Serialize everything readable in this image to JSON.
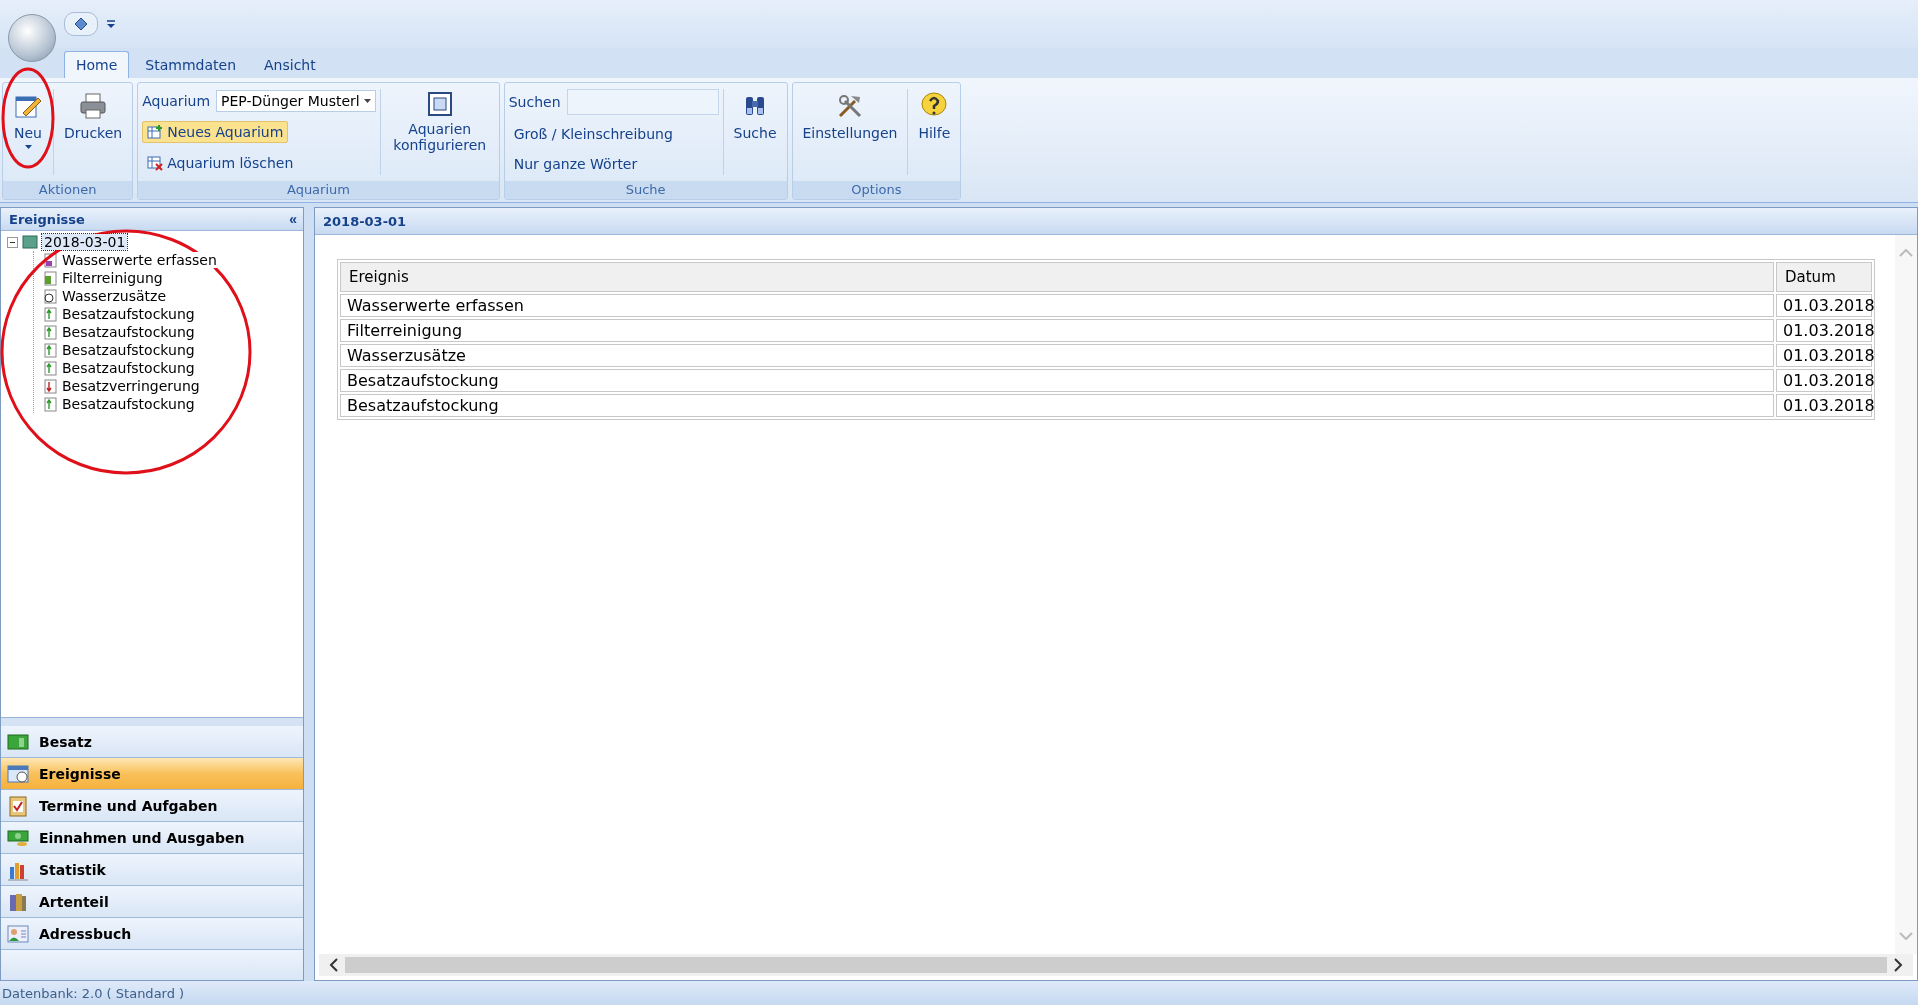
{
  "ribbon_tabs": [
    {
      "label": "Home",
      "selected": true
    },
    {
      "label": "Stammdaten",
      "selected": false
    },
    {
      "label": "Ansicht",
      "selected": false
    }
  ],
  "ribbon_groups": [
    {
      "title": "Aktionen",
      "kind": "actions",
      "buttons": [
        {
          "label": "Neu",
          "dropdown": true
        },
        {
          "label": "Drucken",
          "dropdown": false
        }
      ]
    },
    {
      "title": "Aquarium",
      "kind": "aquarium",
      "field_label": "Aquarium",
      "combo_value": "PEP-Dünger Musterl",
      "new_button": "Neues Aquarium",
      "delete_button": "Aquarium löschen",
      "configure_button": "Aquarien konfigurieren"
    },
    {
      "title": "Suche",
      "kind": "search",
      "field_label": "Suchen",
      "options": [
        "Groß / Kleinschreibung",
        "Nur ganze Wörter"
      ],
      "search_button": "Suche"
    },
    {
      "title": "Options",
      "kind": "actions",
      "buttons": [
        {
          "label": "Einstellungen",
          "dropdown": false
        },
        {
          "label": "Hilfe",
          "dropdown": false
        }
      ]
    }
  ],
  "sidebar": {
    "title": "Ereignisse",
    "collapse": "«",
    "tree": [
      {
        "label": "2018-03-01",
        "selected": true,
        "expanded": true,
        "children": [
          {
            "label": "Wasserwerte erfassen",
            "kind": "measure"
          },
          {
            "label": "Filterreinigung",
            "kind": "filter"
          },
          {
            "label": "Wasserzusätze",
            "kind": "additive"
          },
          {
            "label": "Besatzaufstockung",
            "kind": "increase"
          },
          {
            "label": "Besatzaufstockung",
            "kind": "increase"
          },
          {
            "label": "Besatzaufstockung",
            "kind": "increase"
          },
          {
            "label": "Besatzaufstockung",
            "kind": "increase"
          },
          {
            "label": "Besatzverringerung",
            "kind": "decrease"
          },
          {
            "label": "Besatzaufstockung",
            "kind": "increase"
          }
        ]
      }
    ],
    "nav_items": [
      {
        "label": "Besatz",
        "selected": false
      },
      {
        "label": "Ereignisse",
        "selected": true
      },
      {
        "label": "Termine und Aufgaben",
        "selected": false
      },
      {
        "label": "Einnahmen und Ausgaben",
        "selected": false
      },
      {
        "label": "Statistik",
        "selected": false
      },
      {
        "label": "Artenteil",
        "selected": false
      },
      {
        "label": "Adressbuch",
        "selected": false
      }
    ]
  },
  "content": {
    "title": "2018-03-01",
    "table": {
      "columns": [
        "Ereignis",
        "Datum"
      ],
      "rows": [
        [
          "Wasserwerte erfassen",
          "01.03.2018"
        ],
        [
          "Filterreinigung",
          "01.03.2018"
        ],
        [
          "Wasserzusätze",
          "01.03.2018"
        ],
        [
          "Besatzaufstockung",
          "01.03.2018"
        ],
        [
          "Besatzaufstockung",
          "01.03.2018"
        ]
      ]
    }
  },
  "status_bar": "Datenbank: 2.0 ( Standard )"
}
